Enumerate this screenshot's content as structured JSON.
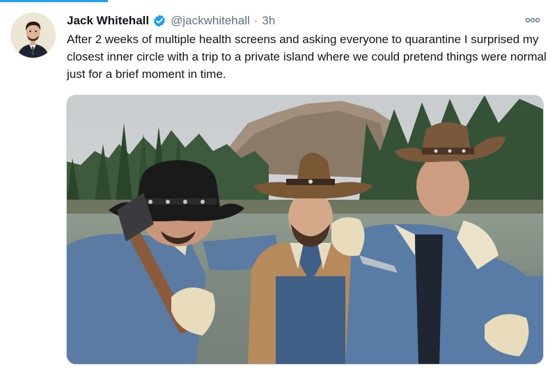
{
  "tweet": {
    "author": {
      "display_name": "Jack Whitehall",
      "handle": "@jackwhitehall",
      "verified": true,
      "avatar_icon": "profile-photo"
    },
    "separator": "·",
    "time": "3h",
    "text": "After 2 weeks of multiple health screens and asking everyone to quarantine I surprised my closest inner circle with a trip to a private island where we could pretend things were normal just for a brief moment in time.",
    "media": {
      "type": "photo"
    },
    "more_icon": "more-options-icon"
  },
  "colors": {
    "accent": "#1da1f2",
    "text": "#0f1419",
    "secondary": "#5b7083"
  }
}
